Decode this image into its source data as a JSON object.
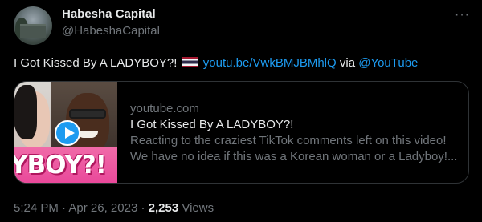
{
  "author": {
    "name": "Habesha Capital",
    "handle": "@HabeshaCapital"
  },
  "tweet": {
    "text": "I Got Kissed By A LADYBOY?!",
    "flag": "thailand-flag",
    "link": "youtu.be/VwkBMJBMhlQ",
    "via": "via",
    "mention": "@YouTube"
  },
  "card": {
    "thumbnail_caption": "YBOY?!",
    "domain": "youtube.com",
    "title": "I Got Kissed By A LADYBOY?!",
    "description_line1": "Reacting to the craziest TikTok comments left on this video!",
    "description_line2": "We have no idea if this was a Korean woman or a Ladyboy!..."
  },
  "meta": {
    "time": "5:24 PM",
    "separator": "·",
    "date": "Apr 26, 2023",
    "views_count": "2,253",
    "views_label": "Views"
  },
  "colors": {
    "background": "#000000",
    "text": "#e7e9ea",
    "muted": "#71767b",
    "link": "#1d9bf0",
    "border": "#2f3336"
  }
}
